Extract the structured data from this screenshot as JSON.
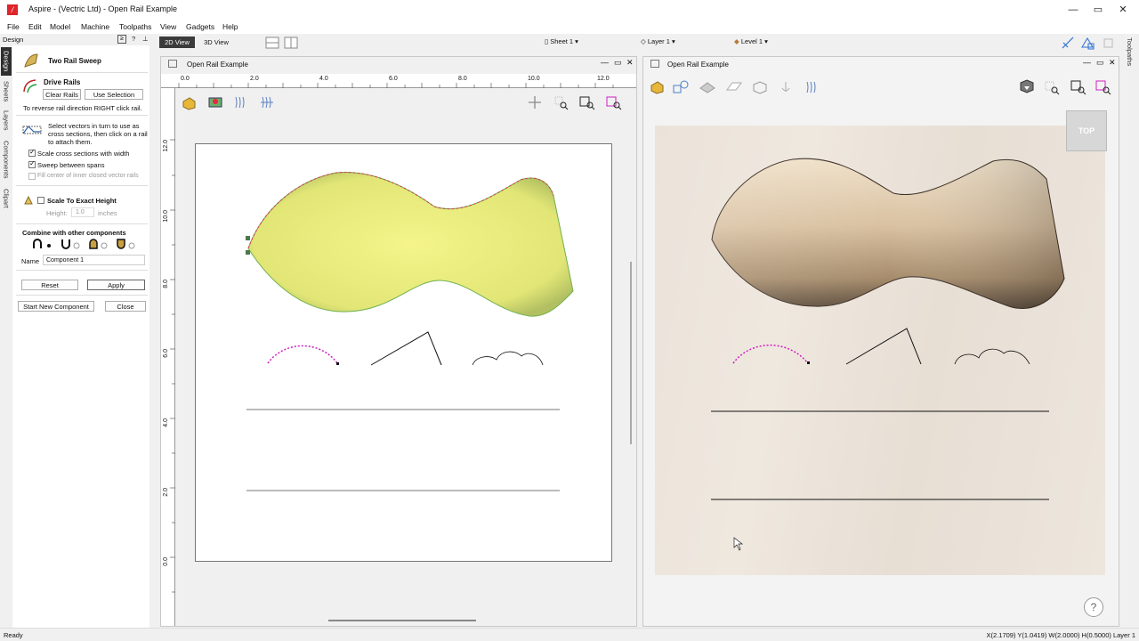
{
  "app": {
    "title": "Aspire - (Vectric Ltd) - Open Rail Example",
    "icon_letter": "/",
    "minimize": "—",
    "restore": "▭",
    "close": "✕"
  },
  "menu": [
    "File",
    "Edit",
    "Model",
    "Machine",
    "Toolpaths",
    "View",
    "Gadgets",
    "Help"
  ],
  "toolbar": {
    "view_2d": "2D View",
    "view_3d": "3D View",
    "sheet": "Sheet 1",
    "layer": "Layer 1",
    "level": "Level 1"
  },
  "left_panel": {
    "header": "Design",
    "vertical_tabs": [
      "Design",
      "Sheets",
      "Layers",
      "Components",
      "Clipart"
    ],
    "tool_title": "Two Rail Sweep",
    "drive_rails_title": "Drive Rails",
    "clear_rails": "Clear Rails",
    "use_selection": "Use Selection",
    "reverse_hint": "To reverse rail direction RIGHT click rail.",
    "cross_section_hint": [
      "Select vectors in turn to use as",
      "cross sections, then click on a rail",
      "to attach them."
    ],
    "opt_scale_width": "Scale cross sections with width",
    "opt_sweep_spans": "Sweep between spans",
    "opt_fill_center": "Fill center of inner closed vector rails",
    "scale_exact": "Scale To Exact Height",
    "height_label": "Height:",
    "height_value": "1.0",
    "height_unit": "inches",
    "combine_title": "Combine with other components",
    "name_label": "Name",
    "name_value": "Component 1",
    "reset": "Reset",
    "apply": "Apply",
    "start_new": "Start New Component",
    "close": "Close"
  },
  "view2d": {
    "title": "Open Rail Example",
    "ruler_top": [
      "0.0",
      "2.0",
      "4.0",
      "6.0",
      "8.0",
      "10.0",
      "12.0"
    ],
    "ruler_left": [
      "12.0",
      "10.0",
      "8.0",
      "6.0",
      "4.0",
      "2.0",
      "0.0"
    ]
  },
  "view3d": {
    "title": "Open Rail Example",
    "top_button": "TOP",
    "help": "?"
  },
  "right_tab": "Toolpaths",
  "status": {
    "left": "Ready",
    "right": "X(2.1709) Y(1.0419)   W(2.0000) H(0.5000) Layer 1"
  }
}
